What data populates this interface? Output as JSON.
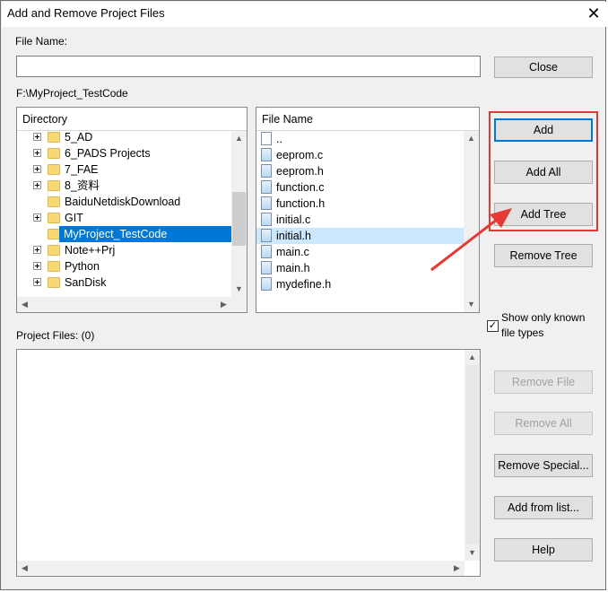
{
  "window": {
    "title": "Add and Remove Project Files",
    "close_glyph": "✕"
  },
  "file_name": {
    "label": "File Name:",
    "value": ""
  },
  "current_path": "F:\\MyProject_TestCode",
  "directory": {
    "header": "Directory",
    "items": [
      {
        "label": "5_AD",
        "expandable": true
      },
      {
        "label": "6_PADS Projects",
        "expandable": true
      },
      {
        "label": "7_FAE",
        "expandable": true
      },
      {
        "label": "8_资料",
        "expandable": true
      },
      {
        "label": "BaiduNetdiskDownload",
        "expandable": false
      },
      {
        "label": "GIT",
        "expandable": true
      },
      {
        "label": "MyProject_TestCode",
        "expandable": false,
        "selected": true
      },
      {
        "label": "Note++Prj",
        "expandable": true
      },
      {
        "label": "Python",
        "expandable": true
      },
      {
        "label": "SanDisk",
        "expandable": true
      }
    ]
  },
  "file_list": {
    "header": "File Name",
    "items": [
      {
        "label": "..",
        "type": "parent"
      },
      {
        "label": "eeprom.c",
        "type": "c"
      },
      {
        "label": "eeprom.h",
        "type": "c"
      },
      {
        "label": "function.c",
        "type": "c"
      },
      {
        "label": "function.h",
        "type": "c"
      },
      {
        "label": "initial.c",
        "type": "c"
      },
      {
        "label": "initial.h",
        "type": "c",
        "highlighted": true
      },
      {
        "label": "main.c",
        "type": "c"
      },
      {
        "label": "main.h",
        "type": "c"
      },
      {
        "label": "mydefine.h",
        "type": "c"
      }
    ]
  },
  "project_files": {
    "label": "Project Files: (0)"
  },
  "show_known": {
    "label_line1": "Show only known",
    "label_line2": "file types",
    "checked": true,
    "check_glyph": "✓"
  },
  "buttons": {
    "close": "Close",
    "add": "Add",
    "add_all": "Add All",
    "add_tree": "Add Tree",
    "remove_tree": "Remove Tree",
    "remove_file": "Remove File",
    "remove_all": "Remove All",
    "remove_special": "Remove Special...",
    "add_from_list": "Add from list...",
    "help": "Help"
  },
  "scroll_glyphs": {
    "up": "▲",
    "down": "▼",
    "left": "◀",
    "right": "▶"
  },
  "colors": {
    "selection": "#0078d7",
    "highlight": "#cce8ff",
    "annotation_red": "#e53935",
    "default_button_border": "#0078d7"
  }
}
